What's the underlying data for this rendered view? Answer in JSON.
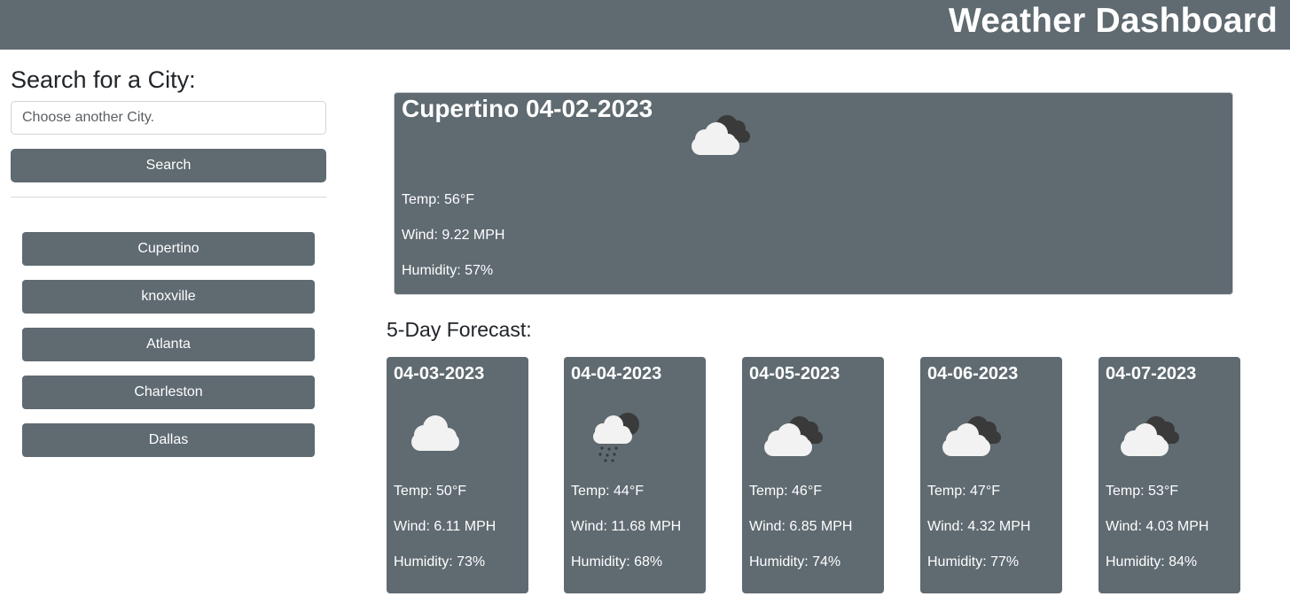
{
  "header": {
    "title": "Weather Dashboard"
  },
  "search": {
    "heading": "Search for a City:",
    "placeholder": "Choose another City.",
    "button_label": "Search"
  },
  "history": [
    "Cupertino",
    "knoxville",
    "Atlanta",
    "Charleston",
    "Dallas"
  ],
  "current": {
    "title": "Cupertino 04-02-2023",
    "icon": "broken-clouds-icon",
    "temp": "Temp: 56°F",
    "wind": "Wind: 9.22 MPH",
    "humidity": "Humidity: 57%"
  },
  "forecast": {
    "heading": "5-Day Forecast:",
    "days": [
      {
        "date": "04-03-2023",
        "icon": "cloud-icon",
        "temp": "Temp: 50°F",
        "wind": "Wind: 6.11 MPH",
        "humidity": "Humidity: 73%"
      },
      {
        "date": "04-04-2023",
        "icon": "rain-icon",
        "temp": "Temp: 44°F",
        "wind": "Wind: 11.68 MPH",
        "humidity": "Humidity: 68%"
      },
      {
        "date": "04-05-2023",
        "icon": "broken-clouds-icon",
        "temp": "Temp: 46°F",
        "wind": "Wind: 6.85 MPH",
        "humidity": "Humidity: 74%"
      },
      {
        "date": "04-06-2023",
        "icon": "broken-clouds-icon",
        "temp": "Temp: 47°F",
        "wind": "Wind: 4.32 MPH",
        "humidity": "Humidity: 77%"
      },
      {
        "date": "04-07-2023",
        "icon": "broken-clouds-icon",
        "temp": "Temp: 53°F",
        "wind": "Wind: 4.03 MPH",
        "humidity": "Humidity: 84%"
      }
    ]
  },
  "colors": {
    "primary": "#5f6a71",
    "text": "#212529",
    "card_text": "#ffffff"
  }
}
